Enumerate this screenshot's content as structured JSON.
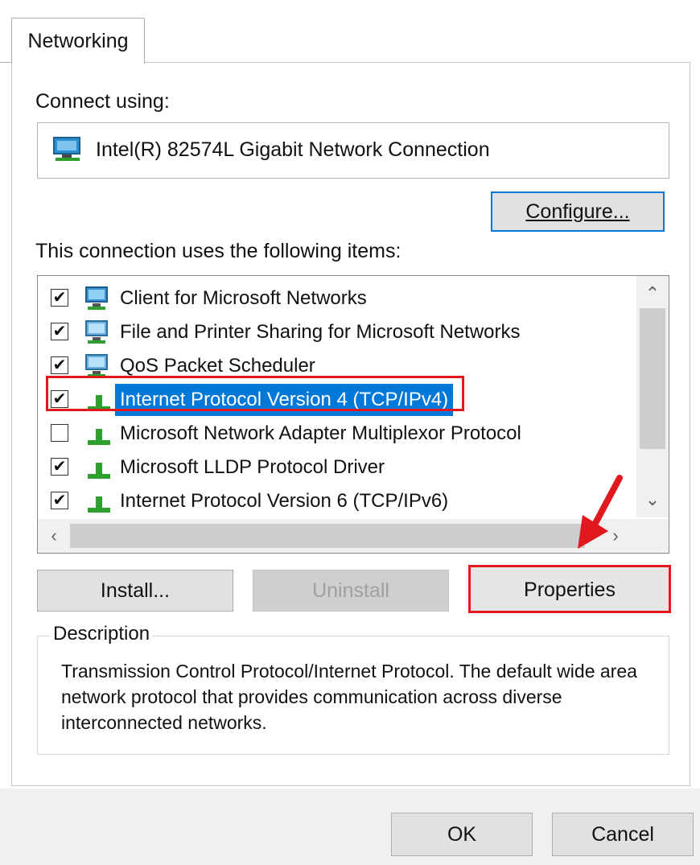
{
  "tab": {
    "label": "Networking"
  },
  "connect": {
    "label": "Connect using:",
    "adapter": "Intel(R) 82574L Gigabit Network Connection",
    "configure_label": "Configure..."
  },
  "items_label": "This connection uses the following items:",
  "items": [
    {
      "label": "Client for Microsoft Networks",
      "checked": true,
      "icon": "network-client-icon"
    },
    {
      "label": "File and Printer Sharing for Microsoft Networks",
      "checked": true,
      "icon": "network-service-icon"
    },
    {
      "label": "QoS Packet Scheduler",
      "checked": true,
      "icon": "network-service-icon"
    },
    {
      "label": "Internet Protocol Version 4 (TCP/IPv4)",
      "checked": true,
      "icon": "protocol-icon",
      "selected": true
    },
    {
      "label": "Microsoft Network Adapter Multiplexor Protocol",
      "checked": false,
      "icon": "protocol-icon"
    },
    {
      "label": "Microsoft LLDP Protocol Driver",
      "checked": true,
      "icon": "protocol-icon"
    },
    {
      "label": "Internet Protocol Version 6 (TCP/IPv6)",
      "checked": true,
      "icon": "protocol-icon"
    }
  ],
  "buttons": {
    "install": "Install...",
    "uninstall": "Uninstall",
    "properties": "Properties",
    "ok": "OK",
    "cancel": "Cancel"
  },
  "description": {
    "legend": "Description",
    "text": "Transmission Control Protocol/Internet Protocol. The default wide area network protocol that provides communication across diverse interconnected networks."
  },
  "colors": {
    "accent": "#0078d7",
    "highlight_red": "#e0191f"
  }
}
